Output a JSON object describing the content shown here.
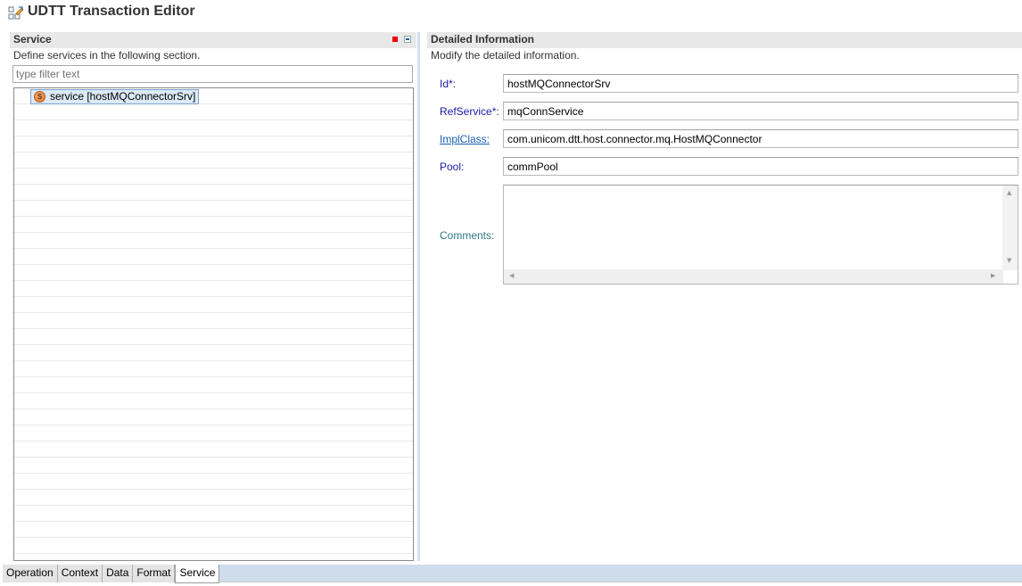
{
  "editor": {
    "title": "UDTT Transaction Editor",
    "icon": "transaction-editor-icon"
  },
  "service_section": {
    "title": "Service",
    "description": "Define services in the following section.",
    "filter_placeholder": "type filter text",
    "filter_value": "",
    "toolbar_icons": [
      "red-stop-icon",
      "expand-all-icon"
    ],
    "tree_items": [
      {
        "icon": "service-icon",
        "icon_glyph": "S",
        "label": "service [hostMQConnectorSrv]",
        "selected": true
      }
    ]
  },
  "detail_section": {
    "title": "Detailed Information",
    "description": "Modify the detailed information.",
    "fields": [
      {
        "label": "Id*:",
        "value": "hostMQConnectorSrv"
      },
      {
        "label": "RefService*:",
        "value": "mqConnService"
      },
      {
        "label": "ImplClass:",
        "value": "com.unicom.dtt.host.connector.mq.HostMQConnector",
        "is_link": true
      },
      {
        "label": "Pool:",
        "value": "commPool"
      }
    ],
    "comments": {
      "label": "Comments:",
      "value": ""
    }
  },
  "bottom_tabs": [
    {
      "label": "Operation",
      "active": false
    },
    {
      "label": "Context",
      "active": false
    },
    {
      "label": "Data",
      "active": false
    },
    {
      "label": "Format",
      "active": false
    },
    {
      "label": "Service",
      "active": true
    }
  ],
  "colors": {
    "label_blue": "#1a1aa6",
    "link_blue": "#1a5fb4",
    "comments_teal": "#2e7a84",
    "section_header_bg": "#e8e8e8",
    "tabbar_bg": "#cfdcea",
    "selection_bg": "#dce9f7"
  }
}
